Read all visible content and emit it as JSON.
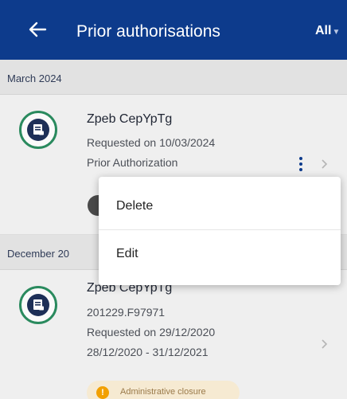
{
  "app_bar": {
    "title": "Prior authorisations",
    "filter_label": "All",
    "back_icon": "arrow-left-icon",
    "filter_icon": "caret-down-icon",
    "background_color": "#0d3b8c"
  },
  "sections": [
    {
      "header": "March 2024",
      "items": [
        {
          "name": "Zpeb CepYpTg",
          "lines": [
            "Requested on 10/03/2024",
            "Prior Authorization"
          ],
          "icon": "document-icon"
        }
      ]
    },
    {
      "header": "December 20",
      "items": [
        {
          "name": "Zpeb CepYpTg",
          "lines": [
            "201229.F97971",
            "Requested on 29/12/2020",
            "28/12/2020 - 31/12/2021"
          ],
          "status": "Administrative closure",
          "status_icon": "warning-icon",
          "icon": "document-icon"
        }
      ]
    }
  ],
  "context_menu": {
    "items": [
      {
        "label": "Delete"
      },
      {
        "label": "Edit"
      }
    ]
  },
  "colors": {
    "accent": "#2a8a5e",
    "icon_fill": "#1d2f57",
    "warning": "#f2a000"
  }
}
